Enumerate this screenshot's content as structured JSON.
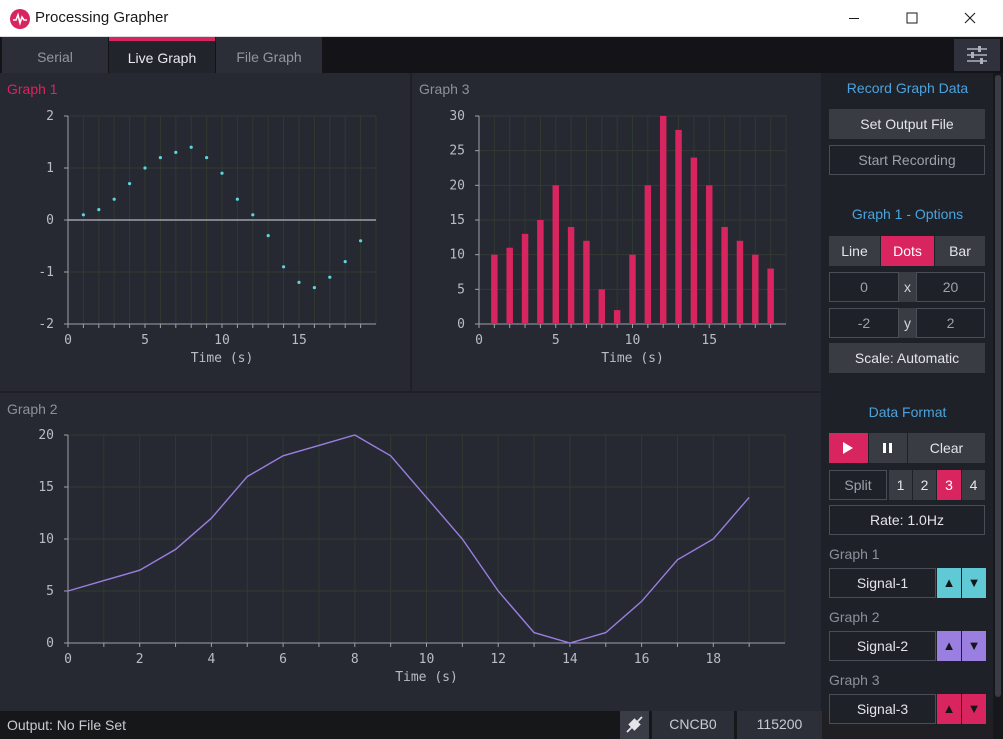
{
  "window": {
    "title": "Processing Grapher"
  },
  "tabs": [
    {
      "label": "Serial",
      "active": false
    },
    {
      "label": "Live Graph",
      "active": true
    },
    {
      "label": "File Graph",
      "active": false
    }
  ],
  "graphs": {
    "g1": {
      "title": "Graph 1",
      "title_color": "#d9255f"
    },
    "g2": {
      "title": "Graph 2",
      "title_color": "#8b919c"
    },
    "g3": {
      "title": "Graph 3",
      "title_color": "#8b919c"
    }
  },
  "chart_data": [
    {
      "type": "scatter",
      "title": "Graph 1",
      "xlabel": "Time (s)",
      "xlim": [
        0,
        20
      ],
      "ylim": [
        -2,
        2
      ],
      "xticks": [
        0,
        5,
        10,
        15
      ],
      "yticks": [
        -2,
        -1,
        0,
        1,
        2
      ],
      "color": "#5fd3e0",
      "x": [
        1,
        2,
        3,
        4,
        5,
        6,
        7,
        8,
        9,
        10,
        11,
        12,
        13,
        14,
        15,
        16,
        17,
        18,
        19
      ],
      "y": [
        0.1,
        0.2,
        0.4,
        0.7,
        1.0,
        1.2,
        1.3,
        1.4,
        1.2,
        0.9,
        0.4,
        0.1,
        -0.3,
        -0.9,
        -1.2,
        -1.3,
        -1.1,
        -0.8,
        -0.4
      ]
    },
    {
      "type": "bar",
      "title": "Graph 3",
      "xlabel": "Time (s)",
      "xlim": [
        0,
        20
      ],
      "ylim": [
        0,
        30
      ],
      "xticks": [
        0,
        5,
        10,
        15
      ],
      "yticks": [
        0,
        5,
        10,
        15,
        20,
        25,
        30
      ],
      "color": "#d9255f",
      "x": [
        1,
        2,
        3,
        4,
        5,
        6,
        7,
        8,
        9,
        10,
        11,
        12,
        13,
        14,
        15,
        16,
        17,
        18,
        19
      ],
      "values": [
        10,
        11,
        13,
        15,
        20,
        14,
        12,
        5,
        2,
        10,
        20,
        30,
        28,
        24,
        20,
        14,
        12,
        10,
        8
      ]
    },
    {
      "type": "line",
      "title": "Graph 2",
      "xlabel": "Time (s)",
      "xlim": [
        0,
        20
      ],
      "ylim": [
        0,
        20
      ],
      "xticks": [
        0,
        2,
        4,
        6,
        8,
        10,
        12,
        14,
        16,
        18
      ],
      "yticks": [
        0,
        5,
        10,
        15,
        20
      ],
      "color": "#9a7ee0",
      "x": [
        0,
        1,
        2,
        3,
        4,
        5,
        6,
        7,
        8,
        9,
        10,
        11,
        12,
        13,
        14,
        15,
        16,
        17,
        18,
        19
      ],
      "y": [
        5,
        6,
        7,
        9,
        12,
        16,
        18,
        19,
        20,
        18,
        14,
        10,
        5,
        1,
        0,
        1,
        4,
        8,
        10,
        14
      ]
    }
  ],
  "sidebar": {
    "record_title": "Record Graph Data",
    "set_output_label": "Set Output File",
    "start_recording_label": "Start Recording",
    "options_title": "Graph 1 - Options",
    "type_buttons": {
      "line": "Line",
      "dots": "Dots",
      "bar": "Bar",
      "selected": "Dots"
    },
    "x_min": "0",
    "x_label": "x",
    "x_max": "20",
    "y_min": "-2",
    "y_label": "y",
    "y_max": "2",
    "scale_label": "Scale: Automatic",
    "data_format_title": "Data Format",
    "clear_label": "Clear",
    "split_label": "Split",
    "split_options": [
      "1",
      "2",
      "3",
      "4"
    ],
    "split_selected": "3",
    "rate_label": "Rate: 1.0Hz",
    "signals": [
      {
        "graph_label": "Graph 1",
        "signal": "Signal-1",
        "color": "#5fc9d6"
      },
      {
        "graph_label": "Graph 2",
        "signal": "Signal-2",
        "color": "#9a7ee0"
      },
      {
        "graph_label": "Graph 3",
        "signal": "Signal-3",
        "color": "#d9255f"
      }
    ],
    "up_icon": "▲",
    "down_icon": "▼"
  },
  "status": {
    "output_text": "Output: No File Set",
    "port": "CNCB0",
    "baud": "115200",
    "connection_icon": "plug-icon"
  }
}
